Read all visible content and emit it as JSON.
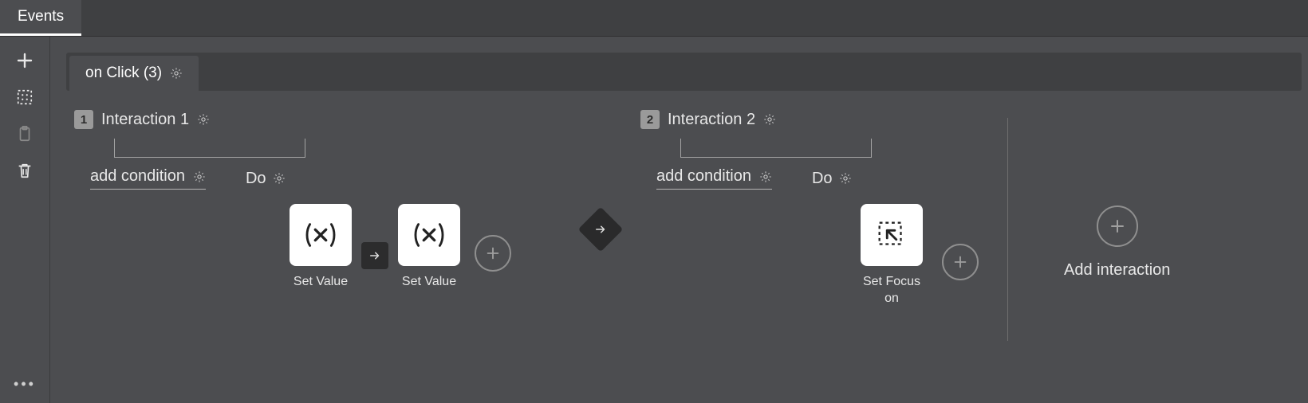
{
  "topbar": {
    "tab": "Events"
  },
  "event": {
    "label": "on Click (3)"
  },
  "labels": {
    "add_condition": "add condition",
    "do": "Do",
    "add_interaction": "Add interaction"
  },
  "interactions": [
    {
      "index": "1",
      "name": "Interaction 1",
      "actions": [
        {
          "label": "Set Value",
          "icon": "variable-icon"
        },
        {
          "label": "Set Value",
          "icon": "variable-icon"
        }
      ]
    },
    {
      "index": "2",
      "name": "Interaction 2",
      "actions": [
        {
          "label": "Set Focus on",
          "icon": "focus-icon"
        }
      ]
    }
  ]
}
